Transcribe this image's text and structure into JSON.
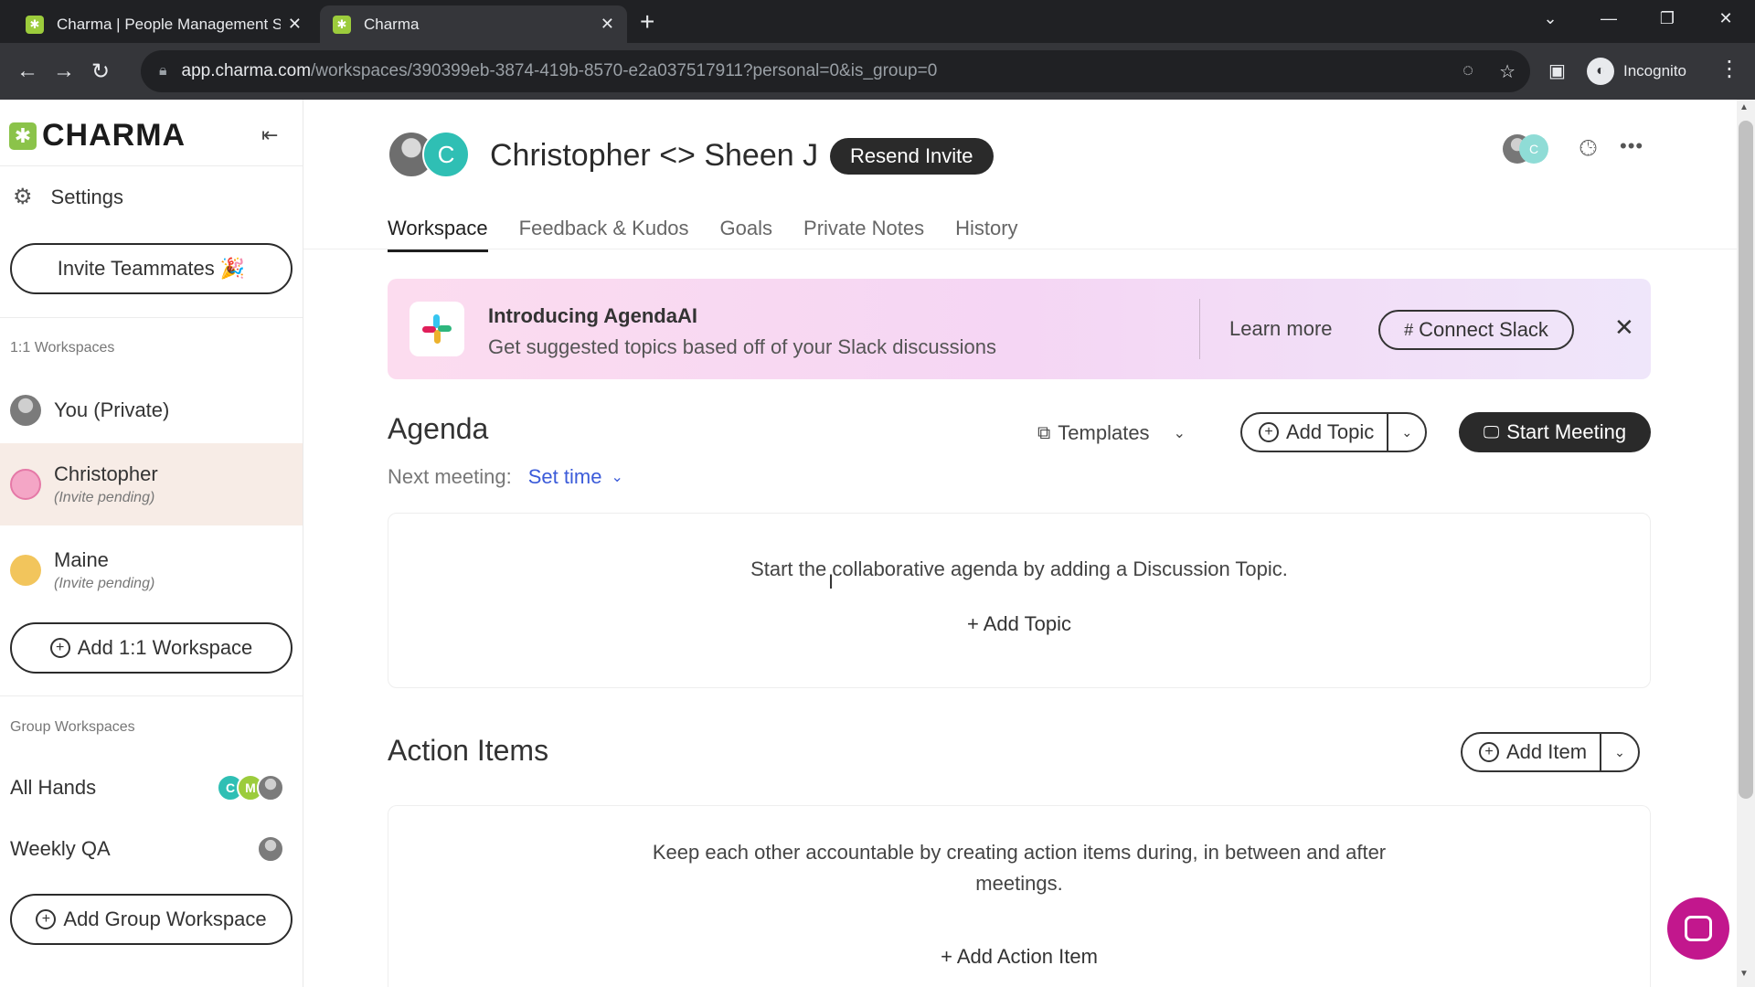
{
  "browser": {
    "tabs": [
      {
        "title": "Charma | People Management S",
        "active": false
      },
      {
        "title": "Charma",
        "active": true
      }
    ],
    "url_host": "app.charma.com",
    "url_path": "/workspaces/390399eb-3874-419b-8570-e2a037517911?personal=0&is_group=0",
    "profile_label": "Incognito"
  },
  "sidebar": {
    "logo": "CHARMA",
    "settings_label": "Settings",
    "invite_label": "Invite Teammates 🎉",
    "one_on_one_label": "1:1 Workspaces",
    "workspaces": [
      {
        "name": "You (Private)",
        "sub": ""
      },
      {
        "name": "Christopher",
        "sub": "(Invite pending)"
      },
      {
        "name": "Maine",
        "sub": "(Invite pending)"
      }
    ],
    "add_workspace_label": "Add 1:1 Workspace",
    "group_label": "Group Workspaces",
    "groups": [
      {
        "name": "All Hands",
        "avatars": [
          "C",
          "M",
          ""
        ]
      },
      {
        "name": "Weekly QA",
        "avatars": [
          ""
        ]
      }
    ],
    "add_group_label": "Add Group Workspace"
  },
  "header": {
    "avatar_initial": "C",
    "title": "Christopher <> Sheen J",
    "resend_label": "Resend Invite",
    "right_avatar_initial": "C"
  },
  "tabs": [
    "Workspace",
    "Feedback & Kudos",
    "Goals",
    "Private Notes",
    "History"
  ],
  "banner": {
    "title": "Introducing AgendaAI",
    "subtitle": "Get suggested topics based off of your Slack discussions",
    "learn_more": "Learn more",
    "connect_label": "Connect Slack"
  },
  "agenda": {
    "title": "Agenda",
    "templates_label": "Templates",
    "add_topic_label": "Add Topic",
    "start_meeting_label": "Start Meeting",
    "next_meeting_label": "Next meeting:",
    "set_time_label": "Set time",
    "empty_text": "Start the collaborative agenda by adding a Discussion Topic.",
    "empty_action": "+ Add Topic"
  },
  "action_items": {
    "title": "Action Items",
    "add_item_label": "Add Item",
    "empty_text": "Keep each other accountable by creating action items during, in between and after meetings.",
    "empty_action": "+ Add Action Item"
  },
  "colors": {
    "brand_green": "#8bc34a",
    "link_blue": "#3b5bd9",
    "chat_magenta": "#c2178d",
    "selected_bg": "#f7ece6"
  }
}
